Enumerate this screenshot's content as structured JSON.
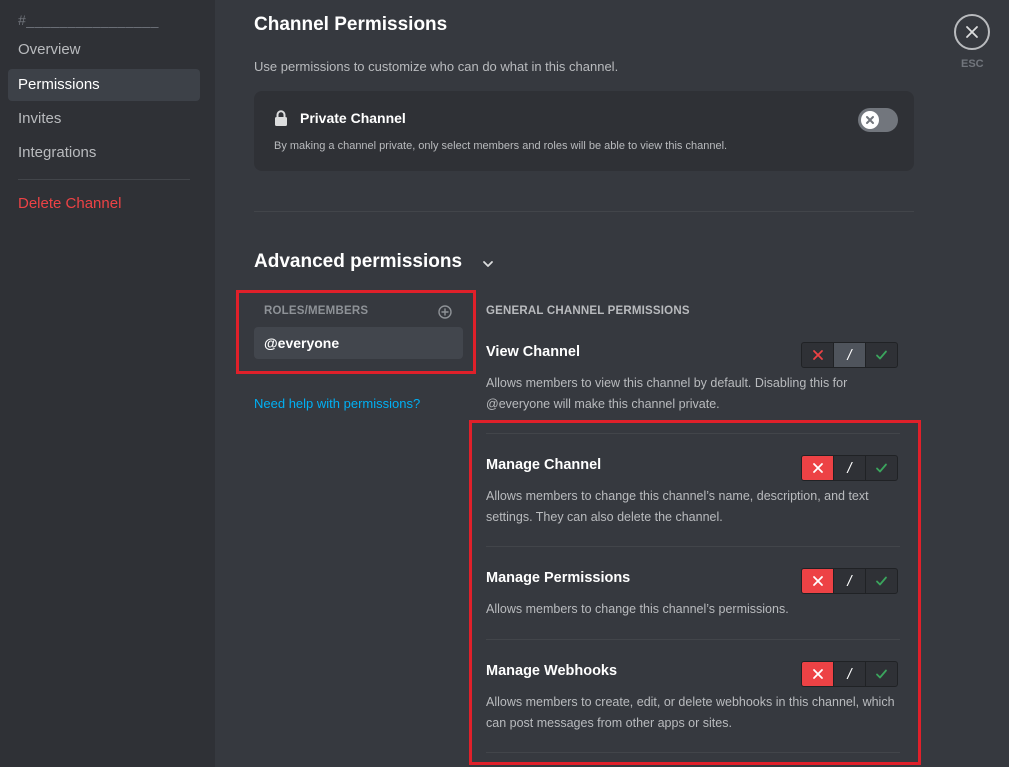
{
  "sidebar": {
    "channel_header": "#________________",
    "items": [
      {
        "label": "Overview"
      },
      {
        "label": "Permissions"
      },
      {
        "label": "Invites"
      },
      {
        "label": "Integrations"
      }
    ],
    "delete_label": "Delete Channel"
  },
  "header": {
    "title": "Channel Permissions",
    "description": "Use permissions to customize who can do what in this channel.",
    "esc_label": "ESC"
  },
  "private_channel": {
    "title": "Private Channel",
    "description": "By making a channel private, only select members and roles will be able to view this channel.",
    "enabled": false
  },
  "advanced": {
    "title": "Advanced permissions",
    "roles_header": "ROLES/MEMBERS",
    "roles": [
      {
        "label": "@everyone",
        "selected": true
      }
    ],
    "help_link": "Need help with permissions?",
    "section_header": "GENERAL CHANNEL PERMISSIONS",
    "permissions": [
      {
        "name": "View Channel",
        "description": "Allows members to view this channel by default. Disabling this for @everyone will make this channel private.",
        "state": "neutral"
      },
      {
        "name": "Manage Channel",
        "description": "Allows members to change this channel’s name, description, and text settings. They can also delete the channel.",
        "state": "deny"
      },
      {
        "name": "Manage Permissions",
        "description": "Allows members to change this channel’s permissions.",
        "state": "deny"
      },
      {
        "name": "Manage Webhooks",
        "description": "Allows members to create, edit, or delete webhooks in this channel, which can post messages from other apps or sites.",
        "state": "deny"
      }
    ]
  },
  "colors": {
    "deny": "#ed4245",
    "allow": "#3ba55d",
    "link": "#00b0f4",
    "highlight": "#e0202a"
  }
}
